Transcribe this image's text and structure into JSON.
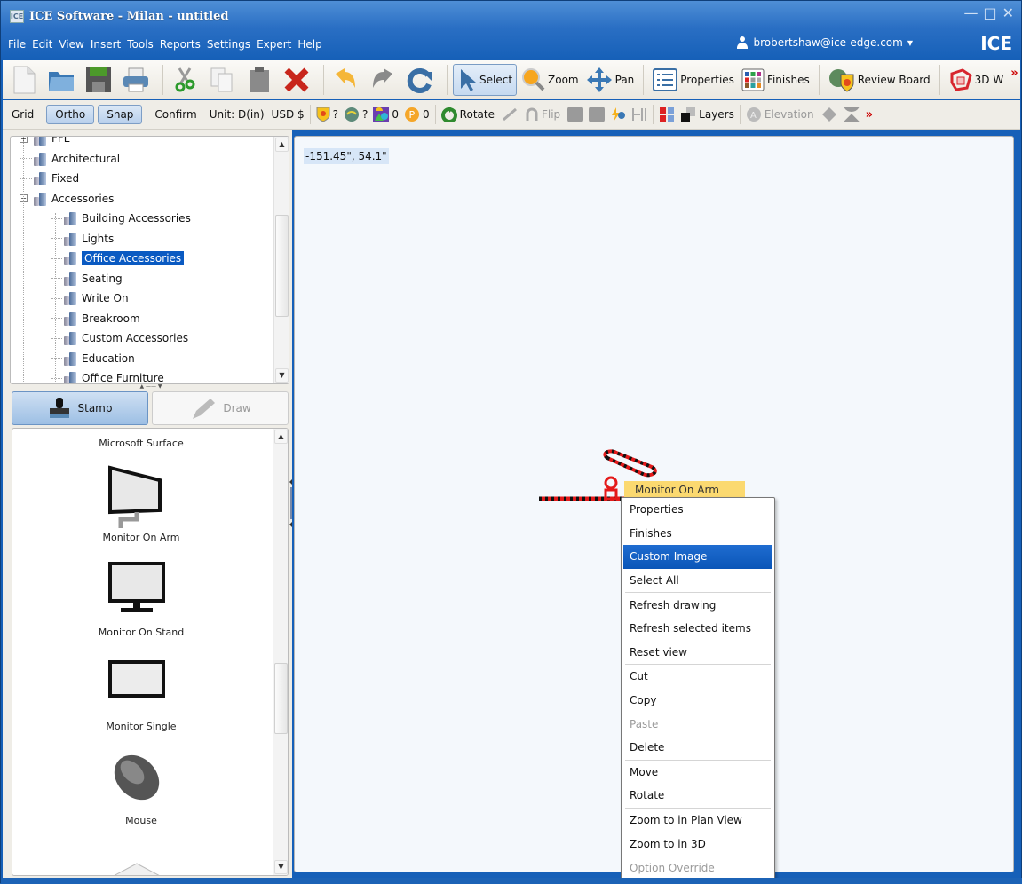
{
  "window": {
    "icon_text": "ICE",
    "title": "ICE Software - Milan - untitled",
    "controls": [
      "minimize",
      "maximize",
      "close"
    ]
  },
  "menubar": {
    "items": [
      "File",
      "Edit",
      "View",
      "Insert",
      "Tools",
      "Reports",
      "Settings",
      "Expert",
      "Help"
    ],
    "user": "brobertshaw@ice-edge.com",
    "brand": "ICE"
  },
  "toolbar1": {
    "file_icons": [
      "new-document-icon",
      "open-folder-icon",
      "save-icon",
      "print-icon"
    ],
    "edit_icons": [
      "cut-icon",
      "copy-icon",
      "paste-icon",
      "delete-icon"
    ],
    "history_icons": [
      "undo-icon",
      "redo-icon",
      "refresh-icon"
    ],
    "select_label": "Select",
    "zoom_label": "Zoom",
    "pan_label": "Pan",
    "properties_label": "Properties",
    "finishes_label": "Finishes",
    "review_board_label": "Review Board",
    "view3d_label": "3D W",
    "overflow": "»"
  },
  "toolbar2": {
    "grid_label": "Grid",
    "ortho_label": "Ortho",
    "snap_label": "Snap",
    "confirm_label": "Confirm",
    "unit_label": "Unit: D(in)",
    "currency_label": "USD $",
    "badge1_value": "?",
    "badge2_value": "?",
    "badge3_value": "0",
    "badge4_value": "0",
    "rotate_label": "Rotate",
    "flip_label": "Flip",
    "layers_label": "Layers",
    "elevation_label": "Elevation",
    "overflow": "»"
  },
  "tree": {
    "items": [
      {
        "label": "FFL",
        "level": 1,
        "expander": "+"
      },
      {
        "label": "Architectural",
        "level": 1
      },
      {
        "label": "Fixed",
        "level": 1
      },
      {
        "label": "Accessories",
        "level": 1,
        "expander": "−"
      },
      {
        "label": "Building Accessories",
        "level": 2
      },
      {
        "label": "Lights",
        "level": 2
      },
      {
        "label": "Office Accessories",
        "level": 2,
        "selected": true
      },
      {
        "label": "Seating",
        "level": 2
      },
      {
        "label": "Write On",
        "level": 2
      },
      {
        "label": "Breakroom",
        "level": 2
      },
      {
        "label": "Custom Accessories",
        "level": 2
      },
      {
        "label": "Education",
        "level": 2
      },
      {
        "label": "Office Furniture",
        "level": 2
      }
    ]
  },
  "modes": {
    "stamp_label": "Stamp",
    "draw_label": "Draw"
  },
  "gallery": {
    "items": [
      {
        "label": "Microsoft Surface",
        "icon": "microsoft-surface-icon"
      },
      {
        "label": "Monitor On Arm",
        "icon": "monitor-on-arm-icon"
      },
      {
        "label": "Monitor On Stand",
        "icon": "monitor-on-stand-icon"
      },
      {
        "label": "Monitor Single",
        "icon": "monitor-single-icon"
      },
      {
        "label": "Mouse",
        "icon": "mouse-icon"
      }
    ]
  },
  "canvas": {
    "coordinates": "-151.45\", 54.1\"",
    "tooltip": "Monitor On Arm"
  },
  "context_menu": {
    "items": [
      {
        "label": "Properties"
      },
      {
        "label": "Finishes"
      },
      {
        "label": "Custom Image",
        "highlighted": true
      },
      {
        "label": "Select All"
      },
      {
        "sep": true
      },
      {
        "label": "Refresh drawing"
      },
      {
        "label": "Refresh selected items"
      },
      {
        "label": "Reset view"
      },
      {
        "sep": true
      },
      {
        "label": "Cut"
      },
      {
        "label": "Copy"
      },
      {
        "label": "Paste",
        "disabled": true
      },
      {
        "label": "Delete"
      },
      {
        "sep": true
      },
      {
        "label": "Move"
      },
      {
        "label": "Rotate"
      },
      {
        "sep": true
      },
      {
        "label": "Zoom to in Plan View"
      },
      {
        "label": "Zoom to in 3D"
      },
      {
        "sep": true
      },
      {
        "label": "Option Override",
        "disabled": true
      }
    ]
  }
}
